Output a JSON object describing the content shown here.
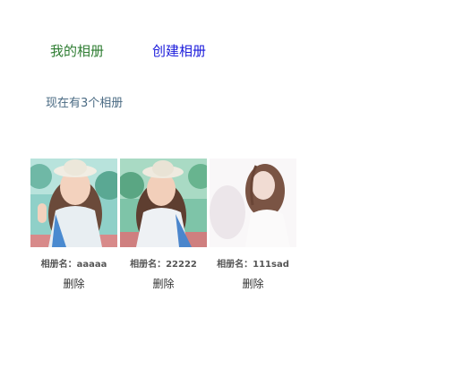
{
  "nav": {
    "my_albums": "我的相册",
    "create_album": "创建相册"
  },
  "status": {
    "album_count_text": "现在有3个相册"
  },
  "albums": [
    {
      "label": "相册名：aaaaa",
      "delete": "删除"
    },
    {
      "label": "相册名：22222",
      "delete": "删除"
    },
    {
      "label": "相册名：111sad",
      "delete": "删除"
    }
  ],
  "colors": {
    "nav_my": "#2e7d32",
    "nav_create": "#1a1adb",
    "count_text": "#4a6a83"
  }
}
